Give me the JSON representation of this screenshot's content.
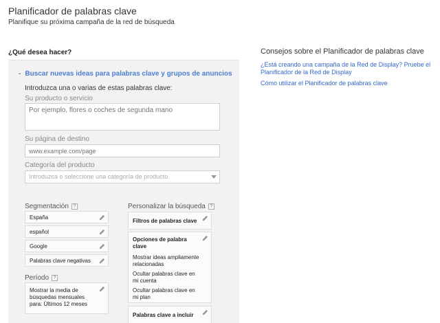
{
  "header": {
    "title": "Planificador de palabras clave",
    "subtitle": "Planifique su próxima campaña de la red de búsqueda"
  },
  "question": "¿Qué desea hacer?",
  "search_section": {
    "toggle_symbol": "-",
    "toggle_label": "Buscar nuevas ideas para palabras clave y grupos de anuncios",
    "intro": "Introduzca una o varias de estas palabras clave:",
    "product_label": "Su producto o servicio",
    "product_placeholder": "Por ejemplo, flores o coches de segunda mano",
    "landing_label": "Su página de destino",
    "landing_placeholder": "www.example.com/page",
    "category_label": "Categoría del producto",
    "category_placeholder": "Introduzca o seleccione una categoría de producto."
  },
  "targeting": {
    "title": "Segmentación",
    "help": "?",
    "items": [
      "España",
      "español",
      "Google",
      "Palabras clave negativas"
    ]
  },
  "period": {
    "title": "Período",
    "help": "?",
    "value": "Mostrar la media de búsquedas mensuales para: Últimos 12 meses"
  },
  "customize": {
    "title": "Personalizar la búsqueda",
    "help": "?",
    "filters_title": "Filtros de palabras clave",
    "options_title": "Opciones de palabra clave",
    "options_items": [
      "Mostrar ideas ampliamente relacionadas",
      "Ocultar palabras clave en mi cuenta",
      "Ocultar palabras clave en mi plan"
    ],
    "include_title": "Palabras clave a incluir"
  },
  "tips": {
    "title": "Consejos sobre el Planificador de palabras clave",
    "links": [
      "¿Está creando una campaña de la Red de Display? Pruebe el Planificador de la Red de Display",
      "Cómo utilizar el Planificador de palabras clave"
    ]
  },
  "icons": {
    "edit": "pencil-icon",
    "help": "help-icon",
    "dropdown": "caret-down-icon"
  },
  "colors": {
    "link": "#3366cc",
    "panel_bg": "#f2f2f2",
    "section_link": "#4a7fd1"
  }
}
